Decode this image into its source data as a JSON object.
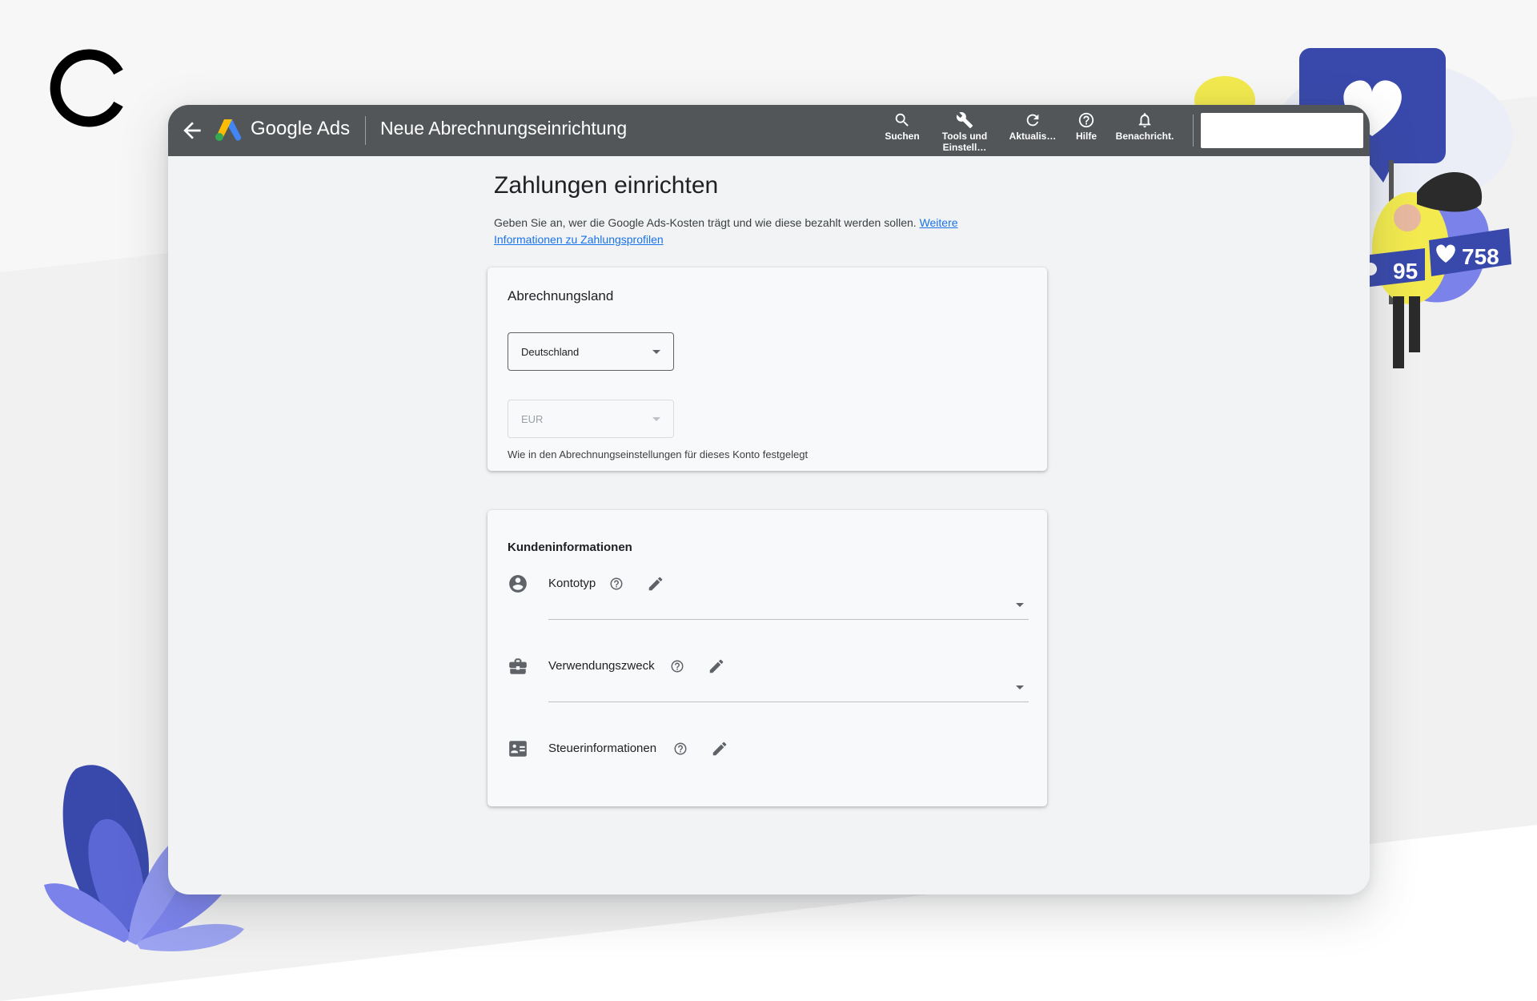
{
  "topbar": {
    "brand": "Google Ads",
    "page_heading": "Neue Abrechnungseinrichtung",
    "tools": [
      {
        "label": "Suchen",
        "icon": "search-icon"
      },
      {
        "label": "Tools und",
        "label2": "Einstell…",
        "icon": "wrench-icon"
      },
      {
        "label": "Aktualis…",
        "icon": "refresh-icon"
      },
      {
        "label": "Hilfe",
        "icon": "help-icon"
      },
      {
        "label": "Benachricht.",
        "icon": "bell-icon"
      }
    ]
  },
  "main": {
    "title": "Zahlungen einrichten",
    "intro_text": "Geben Sie an, wer die Google Ads-Kosten trägt und wie diese bezahlt werden sollen. ",
    "intro_link": "Weitere Informationen zu Zahlungsprofilen"
  },
  "billing_country_card": {
    "title": "Abrechnungsland",
    "country_value": "Deutschland",
    "currency_value": "EUR",
    "hint": "Wie in den Abrechnungseinstellungen für dieses Konto festgelegt"
  },
  "customer_info_card": {
    "title": "Kundeninformationen",
    "rows": [
      {
        "label": "Kontotyp",
        "icon": "account-circle-icon"
      },
      {
        "label": "Verwendungszweck",
        "icon": "briefcase-icon"
      },
      {
        "label": "Steuerinformationen",
        "icon": "id-card-icon"
      }
    ]
  },
  "decor": {
    "stat_followers": "95",
    "stat_likes": "758"
  },
  "colors": {
    "topbar": "#525659",
    "link": "#1a73e8",
    "illustration_blue": "#3949ab",
    "illustration_purple": "#7b83eb",
    "illustration_yellow": "#f2ea4e"
  }
}
